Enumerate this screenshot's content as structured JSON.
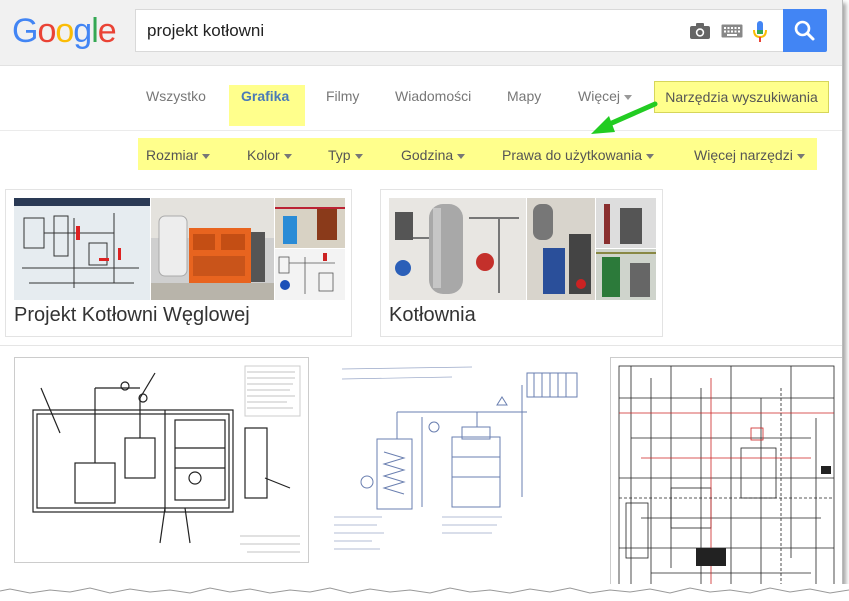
{
  "search": {
    "logo_letters": [
      "G",
      "o",
      "o",
      "g",
      "l",
      "e"
    ],
    "logo_colors": [
      "#4285f4",
      "#ea4335",
      "#fbbc05",
      "#4285f4",
      "#34a853",
      "#ea4335"
    ],
    "query": "projekt kotłowni"
  },
  "tabs": {
    "items": [
      "Wszystko",
      "Grafika",
      "Filmy",
      "Wiadomości",
      "Mapy",
      "Więcej"
    ],
    "active": "Grafika",
    "tools_label": "Narzędzia wyszukiwania"
  },
  "filters": {
    "items": [
      "Rozmiar",
      "Kolor",
      "Typ",
      "Godzina",
      "Prawa do użytkowania",
      "Więcej narzędzi"
    ]
  },
  "collections": [
    {
      "title": "Projekt Kotłowni Węglowej"
    },
    {
      "title": "Kotłownia"
    }
  ],
  "colors": {
    "highlight": "#ffff8c",
    "accent_blue": "#4285f4",
    "arrow_green": "#22cc22"
  }
}
